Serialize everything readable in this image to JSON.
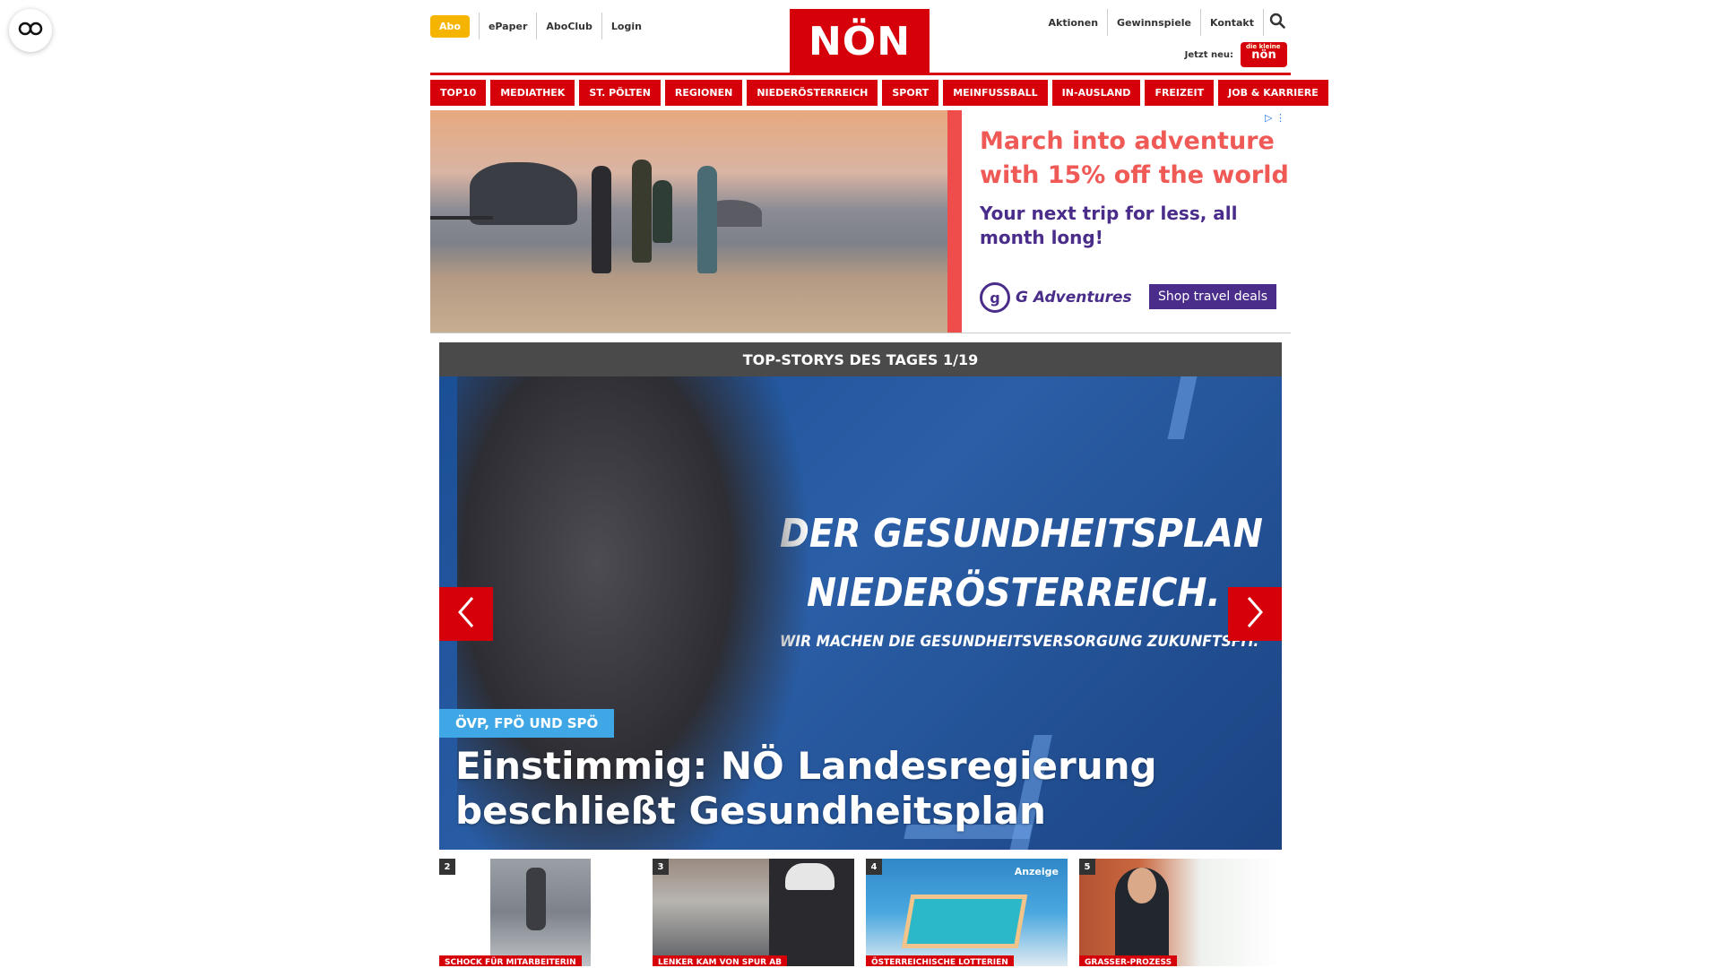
{
  "header": {
    "abo": "Abo",
    "left_links": [
      "ePaper",
      "AboClub",
      "Login"
    ],
    "logo": "NÖN",
    "right_links": [
      "Aktionen",
      "Gewinnspiele",
      "Kontakt"
    ],
    "jetzt_label": "Jetzt neu:",
    "jetzt_logo_small": "die kleine",
    "jetzt_logo": "nön"
  },
  "nav": [
    "TOP10",
    "MEDIATHEK",
    "ST. PÖLTEN",
    "REGIONEN",
    "NIEDERÖSTERREICH",
    "SPORT",
    "MEINFUSSBALL",
    "IN-AUSLAND",
    "FREIZEIT",
    "JOB & KARRIERE"
  ],
  "ad": {
    "headline": "March into adventure with 15% off the world",
    "sub": "Your next trip for less, all month long!",
    "brand": "G Adventures",
    "brand_icon": "g",
    "cta": "Shop travel deals"
  },
  "stories": {
    "heading": "TOP-STORYS DES TAGES 1/19",
    "hero_image_line1": "DER GESUNDHEITSPLAN",
    "hero_image_line2": "NIEDERÖSTERREICH.",
    "hero_image_line3": "WIR MACHEN DIE GESUNDHEITSVERSORGUNG ZUKUNFTSFIT.",
    "hero_tag": "ÖVP, FPÖ UND SPÖ",
    "hero_title": "Einstimmig: NÖ Landesregierung beschließt Gesundheitsplan",
    "thumbs": [
      {
        "num": "2",
        "tag": "SCHOCK FÜR MITARBEITERIN"
      },
      {
        "num": "3",
        "tag": "LENKER KAM VON SPUR AB"
      },
      {
        "num": "4",
        "tag": "ÖSTERREICHISCHE LOTTERIEN",
        "badge": "Anzeige"
      },
      {
        "num": "5",
        "tag": "GRASSER-PROZESS"
      }
    ]
  },
  "colors": {
    "brand_red": "#d6000b",
    "abo_yellow": "#f5b400",
    "ad_coral": "#ef5a57",
    "ad_purple": "#4a2d8a",
    "tag_blue": "#3fa7e6"
  },
  "icons": [
    "accessibility-icon",
    "search-icon",
    "chevron-left-icon",
    "chevron-right-icon",
    "adchoices-icon"
  ]
}
